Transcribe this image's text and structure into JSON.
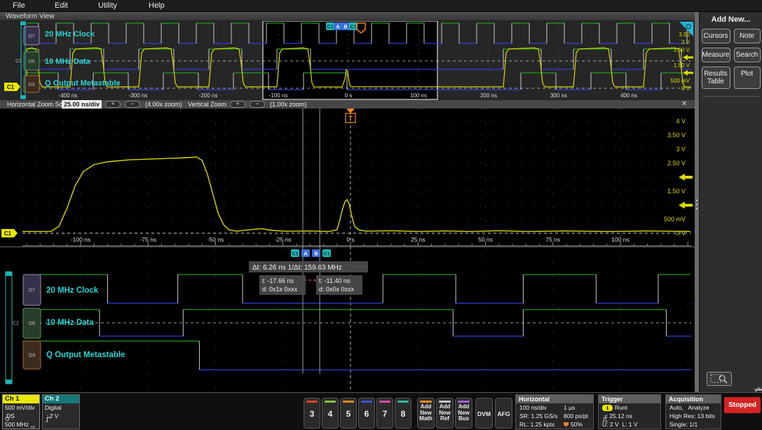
{
  "menu": {
    "items": [
      "File",
      "Edit",
      "Utility",
      "Help"
    ]
  },
  "view_title": "Waveform View",
  "colors": {
    "ch1_yellow": "#d9d900",
    "teal_label": "#2bd5d5",
    "digital_high": "#1f9e1f",
    "digital_low": "#3042d8",
    "trigger_orange": "#f08224",
    "cursor_teal": "#1fb6b6",
    "cursor_blue": "#3a6fd8",
    "stopped_red": "#d42222",
    "ch2_teal": "#137878"
  },
  "overview": {
    "time_labels": [
      {
        "t": -400,
        "label": "-400 ns"
      },
      {
        "t": -300,
        "label": "-300 ns"
      },
      {
        "t": -200,
        "label": "-200 ns"
      },
      {
        "t": -100,
        "label": "-100 ns"
      },
      {
        "t": 0,
        "label": "0 s"
      },
      {
        "t": 100,
        "label": "100 ns"
      },
      {
        "t": 200,
        "label": "200 ns"
      },
      {
        "t": 300,
        "label": "300 ns"
      },
      {
        "t": 400,
        "label": "400 ns"
      }
    ],
    "volt_labels": [
      {
        "v": 3.5,
        "label": "3.50"
      },
      {
        "v": 3,
        "label": "3 V"
      },
      {
        "v": 2.5,
        "label": "2.50 V"
      },
      {
        "v": 1.5,
        "label": "1.50 V"
      },
      {
        "v": 0.5,
        "label": "500 mV"
      },
      {
        "v": 0,
        "label": "0 V"
      }
    ],
    "trigger_levels": [
      2,
      1
    ],
    "channels": [
      {
        "badge": "D7",
        "label": "20 MHz Clock"
      },
      {
        "badge": "D5",
        "label": "10 MHz Data",
        "extra": "C2"
      },
      {
        "badge": "D3",
        "label": "Q Output Metastable"
      }
    ],
    "cursor_badges": [
      "C1",
      "A",
      "B",
      "C1"
    ],
    "c1_badge": "C1"
  },
  "zoombar": {
    "label": "Horizontal Zoom Scale",
    "value": "25.00 ns/div",
    "plus": "+",
    "minus": "−",
    "hzoom": "(4.00x zoom)",
    "vlabel": "Vertical Zoom",
    "vzoom": "(1.00x zoom)",
    "close": "✕"
  },
  "main": {
    "time_labels": [
      {
        "t": -100,
        "label": "-100 ns"
      },
      {
        "t": -75,
        "label": "-75 ns"
      },
      {
        "t": -50,
        "label": "-50 ns"
      },
      {
        "t": -25,
        "label": "-25 ns"
      },
      {
        "t": 0,
        "label": "0 s"
      },
      {
        "t": 25,
        "label": "25 ns"
      },
      {
        "t": 50,
        "label": "50 ns"
      },
      {
        "t": 75,
        "label": "75 ns"
      },
      {
        "t": 100,
        "label": "100 ns"
      }
    ],
    "volt_labels": [
      {
        "v": 4,
        "label": "4 V"
      },
      {
        "v": 3.5,
        "label": "3.50 V"
      },
      {
        "v": 3,
        "label": "3 V"
      },
      {
        "v": 2.5,
        "label": "2.50 V"
      },
      {
        "v": 1.5,
        "label": "1.50 V"
      },
      {
        "v": 0.5,
        "label": "500 mV"
      },
      {
        "v": 0,
        "label": "0 V"
      }
    ],
    "trigger_levels": [
      2,
      1
    ],
    "trigger_marker": "T",
    "c1_badge": "C1"
  },
  "digital": {
    "rows": [
      {
        "badge": "D7",
        "label": "20 MHz Clock"
      },
      {
        "badge": "D5",
        "label": "10 MHz Data",
        "extra": "C2"
      },
      {
        "badge": "D3",
        "label": "Q Output Metastable"
      }
    ],
    "cursor_badges": [
      "C1",
      "A",
      "B",
      "C1"
    ],
    "readout": {
      "dt": "Δt:  6.26 ns 1/Δt:  159.63 MHz",
      "a_t": "t: -17.66 ns",
      "a_d": "d: 0x1x 0xxx",
      "b_t": "t: -11.40 ns",
      "b_d": "d: 0x0x 0xxx"
    }
  },
  "waveforms": {
    "main_trace_V": [
      [
        -123,
        0.06
      ],
      [
        -111,
        0.06
      ],
      [
        -108,
        0.25
      ],
      [
        -105,
        0.9
      ],
      [
        -102,
        1.7
      ],
      [
        -99,
        2.2
      ],
      [
        -95,
        2.45
      ],
      [
        -90,
        2.55
      ],
      [
        -82,
        2.62
      ],
      [
        -70,
        2.66
      ],
      [
        -60,
        2.7
      ],
      [
        -57,
        2.72
      ],
      [
        -55,
        2.6
      ],
      [
        -53,
        2.1
      ],
      [
        -51,
        1.4
      ],
      [
        -49,
        0.7
      ],
      [
        -47,
        0.3
      ],
      [
        -45,
        0.12
      ],
      [
        -42,
        0.07
      ],
      [
        -38,
        0.12
      ],
      [
        -33,
        0.16
      ],
      [
        -29,
        0.1
      ],
      [
        -24,
        0.07
      ],
      [
        -15,
        0.08
      ],
      [
        -8,
        0.06
      ],
      [
        -5,
        0.12
      ],
      [
        -4,
        0.45
      ],
      [
        -3,
        0.85
      ],
      [
        -2,
        1.13
      ],
      [
        -1.3,
        1.2
      ],
      [
        -0.5,
        1.05
      ],
      [
        0.5,
        0.6
      ],
      [
        1.5,
        0.25
      ],
      [
        3,
        0.12
      ],
      [
        6,
        0.07
      ],
      [
        15,
        0.09
      ],
      [
        25,
        0.06
      ],
      [
        35,
        0.08
      ],
      [
        45,
        0.06
      ],
      [
        55,
        0.09
      ],
      [
        65,
        0.06
      ],
      [
        80,
        0.08
      ],
      [
        95,
        0.06
      ],
      [
        110,
        0.08
      ],
      [
        126,
        0.06
      ]
    ],
    "zoom_clock_highs_ns": [
      [
        -115,
        -90
      ],
      [
        -64,
        -40
      ],
      [
        12,
        39
      ],
      [
        64,
        91
      ],
      [
        114,
        126
      ]
    ],
    "zoom_data_highs_ns": [
      [
        -122,
        -93
      ],
      [
        -62,
        38
      ],
      [
        64,
        117
      ]
    ],
    "zoom_q_highs_ns": [
      [
        -122,
        -56
      ]
    ],
    "ov_clock": {
      "period": 50,
      "high": 25,
      "start": -467
    },
    "ov_data_highs": [
      [
        -489,
        -442
      ],
      [
        -397,
        -349
      ],
      [
        -299,
        -249
      ],
      [
        -199,
        -152
      ],
      [
        -102,
        -54
      ],
      [
        221,
        275
      ],
      [
        321,
        375
      ],
      [
        421,
        475
      ]
    ],
    "ov_q_highs": [
      [
        -464,
        -414
      ],
      [
        -364,
        -314
      ],
      [
        -264,
        -214
      ],
      [
        -164,
        -114
      ],
      [
        -64,
        -2
      ],
      [
        246,
        296
      ],
      [
        346,
        396
      ],
      [
        446,
        489
      ]
    ],
    "ov_runt": {
      "t": -2,
      "peak": 1.2
    },
    "cursor_a_ns": -17.66,
    "cursor_b_ns": -11.4
  },
  "sidebar": {
    "title": "Add New...",
    "buttons": [
      "Cursors",
      "Note",
      "Measure",
      "Search",
      "Results\nTable",
      "Plot"
    ]
  },
  "bottom": {
    "ch1": {
      "name": "Ch 1",
      "line1": "500 mV/div",
      "line2": "DS",
      "line3": "500 MHz"
    },
    "ch2": {
      "name": "Ch 2",
      "line1": "Digital",
      "line2": ": 2 V"
    },
    "channels": [
      {
        "label": "3",
        "color": "#e0432a"
      },
      {
        "label": "4",
        "color": "#86c440"
      },
      {
        "label": "5",
        "color": "#f08a24"
      },
      {
        "label": "6",
        "color": "#3a58c8"
      },
      {
        "label": "7",
        "color": "#d84cb0"
      },
      {
        "label": "8",
        "color": "#30b89a"
      }
    ],
    "add_new": [
      {
        "label": "Add\nNew\nMath",
        "color": "#f08a24"
      },
      {
        "label": "Add\nNew\nRef",
        "color": "#c8c8c8"
      },
      {
        "label": "Add\nNew\nBus",
        "color": "#a060e0"
      }
    ],
    "tools": [
      "DVM",
      "AFG"
    ],
    "horizontal": {
      "title": "Horizontal",
      "r1c1": "100 ns/div",
      "r1c2": "1 µs",
      "r2c1": "SR: 1.25 GS/s",
      "r2c2": "800 ps/pt",
      "r3c1": "RL: 1.25 kpts",
      "r3c2": "50%"
    },
    "trigger": {
      "title": "Trigger",
      "source": "1",
      "type": "Runt",
      "row2": "< 25.12 ns",
      "row3": "U: 2 V  L: 1 V"
    },
    "acquisition": {
      "title": "Acquisition",
      "row1": "Auto,   Analyze",
      "row2": "High Res: 13 bits",
      "row3": "Single: 1/1"
    },
    "stopped": "Stopped"
  }
}
